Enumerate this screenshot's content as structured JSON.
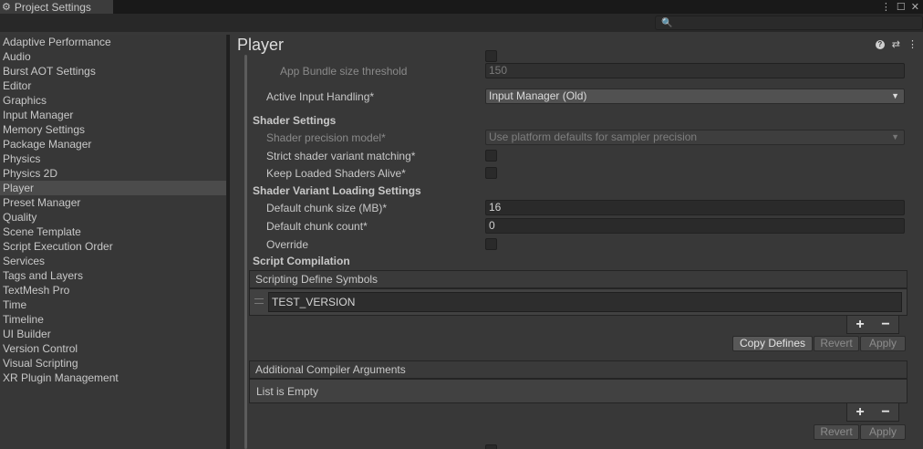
{
  "window": {
    "tab_title": "Project Settings",
    "tab_icon": "gear-icon"
  },
  "search": {
    "placeholder": ""
  },
  "sidebar": {
    "items": [
      {
        "label": "Adaptive Performance"
      },
      {
        "label": "Audio"
      },
      {
        "label": "Burst AOT Settings"
      },
      {
        "label": "Editor"
      },
      {
        "label": "Graphics"
      },
      {
        "label": "Input Manager"
      },
      {
        "label": "Memory Settings"
      },
      {
        "label": "Package Manager"
      },
      {
        "label": "Physics"
      },
      {
        "label": "Physics 2D"
      },
      {
        "label": "Player",
        "selected": true
      },
      {
        "label": "Preset Manager"
      },
      {
        "label": "Quality"
      },
      {
        "label": "Scene Template"
      },
      {
        "label": "Script Execution Order"
      },
      {
        "label": "Services"
      },
      {
        "label": "Tags and Layers"
      },
      {
        "label": "TextMesh Pro"
      },
      {
        "label": "Time"
      },
      {
        "label": "Timeline"
      },
      {
        "label": "UI Builder"
      },
      {
        "label": "Version Control"
      },
      {
        "label": "Visual Scripting"
      },
      {
        "label": "XR Plugin Management"
      }
    ]
  },
  "main": {
    "title": "Player",
    "app_bundle_threshold": {
      "label": "App Bundle size threshold",
      "value": "150"
    },
    "active_input": {
      "label": "Active Input Handling*",
      "value": "Input Manager (Old)"
    },
    "shader_settings": {
      "heading": "Shader Settings",
      "precision_label": "Shader precision model*",
      "precision_value": "Use platform defaults for sampler precision",
      "strict_label": "Strict shader variant matching*",
      "keep_label": "Keep Loaded Shaders Alive*"
    },
    "variant_loading": {
      "heading": "Shader Variant Loading Settings",
      "chunk_size_label": "Default chunk size (MB)*",
      "chunk_size_value": "16",
      "chunk_count_label": "Default chunk count*",
      "chunk_count_value": "0",
      "override_label": "Override"
    },
    "script_compilation": {
      "heading": "Script Compilation",
      "defines_header": "Scripting Define Symbols",
      "defines": [
        "TEST_VERSION"
      ],
      "copy_defines": "Copy Defines",
      "revert": "Revert",
      "apply": "Apply"
    },
    "compiler_args": {
      "header": "Additional Compiler Arguments",
      "empty_text": "List is Empty",
      "revert": "Revert",
      "apply": "Apply"
    },
    "plus": "+",
    "minus": "−"
  }
}
